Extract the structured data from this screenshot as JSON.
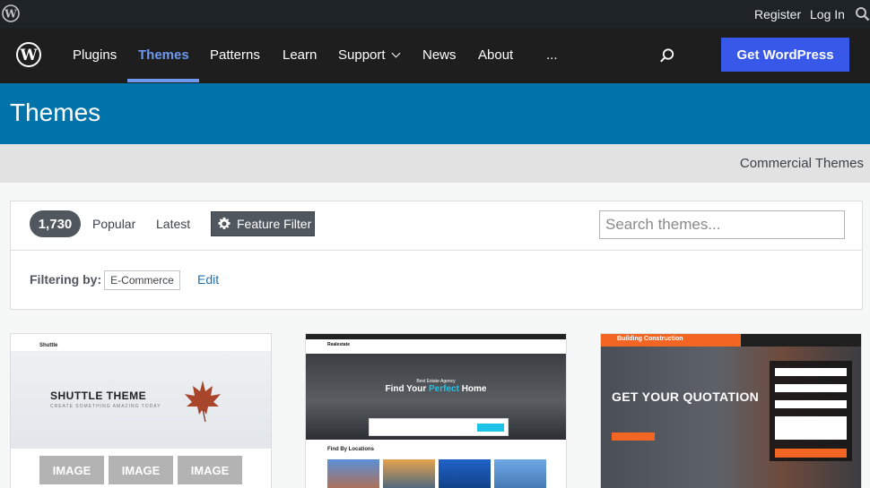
{
  "adminbar": {
    "logo_icon": "wordpress-logo-icon",
    "register": "Register",
    "login": "Log In",
    "search_icon": "search-icon"
  },
  "nav": {
    "items": [
      {
        "label": "Plugins"
      },
      {
        "label": "Themes",
        "active": true
      },
      {
        "label": "Patterns"
      },
      {
        "label": "Learn"
      },
      {
        "label": "Support",
        "has_dropdown": true
      },
      {
        "label": "News"
      },
      {
        "label": "About"
      },
      {
        "label": "..."
      }
    ],
    "cta": "Get WordPress",
    "colors": {
      "bar": "#1e1e1e",
      "active": "#6e99ee",
      "cta": "#3858e9"
    }
  },
  "banner": {
    "title": "Themes",
    "color": "#0073aa"
  },
  "commercial": {
    "link": "Commercial Themes"
  },
  "filters": {
    "count": "1,730",
    "tabs": [
      "Popular",
      "Latest"
    ],
    "feature_filter": "Feature Filter",
    "search_placeholder": "Search themes...",
    "filtering_label": "Filtering by:",
    "active_tag": "E-Commerce",
    "edit": "Edit"
  },
  "themes": [
    {
      "brand": "Shuttle",
      "headline": "SHUTTLE THEME",
      "tagline": "CREATE SOMETHING AMAZING TODAY",
      "image_placeholders": [
        "IMAGE",
        "IMAGE",
        "IMAGE"
      ]
    },
    {
      "brand": "Realestate",
      "badge": "Best Estate Agency",
      "headline_prefix": "Find Your",
      "headline_accent": "Perfect",
      "headline_suffix": "Home",
      "section": "Find By Locations"
    },
    {
      "brand": "Building Construction",
      "headline": "GET YOUR QUOTATION"
    }
  ]
}
